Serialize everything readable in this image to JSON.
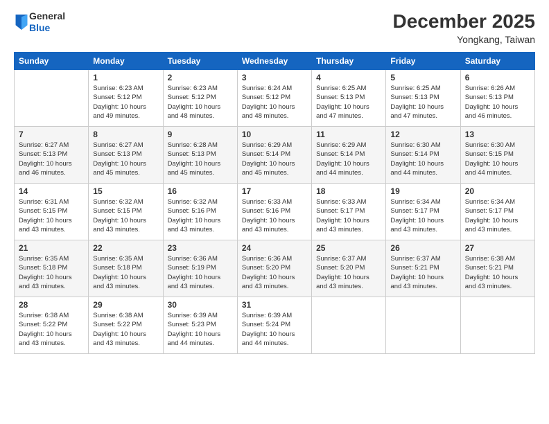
{
  "header": {
    "logo": {
      "general": "General",
      "blue": "Blue"
    },
    "title": "December 2025",
    "location": "Yongkang, Taiwan"
  },
  "calendar": {
    "headers": [
      "Sunday",
      "Monday",
      "Tuesday",
      "Wednesday",
      "Thursday",
      "Friday",
      "Saturday"
    ],
    "weeks": [
      [
        {
          "day": "",
          "info": ""
        },
        {
          "day": "1",
          "info": "Sunrise: 6:23 AM\nSunset: 5:12 PM\nDaylight: 10 hours\nand 49 minutes."
        },
        {
          "day": "2",
          "info": "Sunrise: 6:23 AM\nSunset: 5:12 PM\nDaylight: 10 hours\nand 48 minutes."
        },
        {
          "day": "3",
          "info": "Sunrise: 6:24 AM\nSunset: 5:12 PM\nDaylight: 10 hours\nand 48 minutes."
        },
        {
          "day": "4",
          "info": "Sunrise: 6:25 AM\nSunset: 5:13 PM\nDaylight: 10 hours\nand 47 minutes."
        },
        {
          "day": "5",
          "info": "Sunrise: 6:25 AM\nSunset: 5:13 PM\nDaylight: 10 hours\nand 47 minutes."
        },
        {
          "day": "6",
          "info": "Sunrise: 6:26 AM\nSunset: 5:13 PM\nDaylight: 10 hours\nand 46 minutes."
        }
      ],
      [
        {
          "day": "7",
          "info": "Sunrise: 6:27 AM\nSunset: 5:13 PM\nDaylight: 10 hours\nand 46 minutes."
        },
        {
          "day": "8",
          "info": "Sunrise: 6:27 AM\nSunset: 5:13 PM\nDaylight: 10 hours\nand 45 minutes."
        },
        {
          "day": "9",
          "info": "Sunrise: 6:28 AM\nSunset: 5:13 PM\nDaylight: 10 hours\nand 45 minutes."
        },
        {
          "day": "10",
          "info": "Sunrise: 6:29 AM\nSunset: 5:14 PM\nDaylight: 10 hours\nand 45 minutes."
        },
        {
          "day": "11",
          "info": "Sunrise: 6:29 AM\nSunset: 5:14 PM\nDaylight: 10 hours\nand 44 minutes."
        },
        {
          "day": "12",
          "info": "Sunrise: 6:30 AM\nSunset: 5:14 PM\nDaylight: 10 hours\nand 44 minutes."
        },
        {
          "day": "13",
          "info": "Sunrise: 6:30 AM\nSunset: 5:15 PM\nDaylight: 10 hours\nand 44 minutes."
        }
      ],
      [
        {
          "day": "14",
          "info": "Sunrise: 6:31 AM\nSunset: 5:15 PM\nDaylight: 10 hours\nand 43 minutes."
        },
        {
          "day": "15",
          "info": "Sunrise: 6:32 AM\nSunset: 5:15 PM\nDaylight: 10 hours\nand 43 minutes."
        },
        {
          "day": "16",
          "info": "Sunrise: 6:32 AM\nSunset: 5:16 PM\nDaylight: 10 hours\nand 43 minutes."
        },
        {
          "day": "17",
          "info": "Sunrise: 6:33 AM\nSunset: 5:16 PM\nDaylight: 10 hours\nand 43 minutes."
        },
        {
          "day": "18",
          "info": "Sunrise: 6:33 AM\nSunset: 5:17 PM\nDaylight: 10 hours\nand 43 minutes."
        },
        {
          "day": "19",
          "info": "Sunrise: 6:34 AM\nSunset: 5:17 PM\nDaylight: 10 hours\nand 43 minutes."
        },
        {
          "day": "20",
          "info": "Sunrise: 6:34 AM\nSunset: 5:17 PM\nDaylight: 10 hours\nand 43 minutes."
        }
      ],
      [
        {
          "day": "21",
          "info": "Sunrise: 6:35 AM\nSunset: 5:18 PM\nDaylight: 10 hours\nand 43 minutes."
        },
        {
          "day": "22",
          "info": "Sunrise: 6:35 AM\nSunset: 5:18 PM\nDaylight: 10 hours\nand 43 minutes."
        },
        {
          "day": "23",
          "info": "Sunrise: 6:36 AM\nSunset: 5:19 PM\nDaylight: 10 hours\nand 43 minutes."
        },
        {
          "day": "24",
          "info": "Sunrise: 6:36 AM\nSunset: 5:20 PM\nDaylight: 10 hours\nand 43 minutes."
        },
        {
          "day": "25",
          "info": "Sunrise: 6:37 AM\nSunset: 5:20 PM\nDaylight: 10 hours\nand 43 minutes."
        },
        {
          "day": "26",
          "info": "Sunrise: 6:37 AM\nSunset: 5:21 PM\nDaylight: 10 hours\nand 43 minutes."
        },
        {
          "day": "27",
          "info": "Sunrise: 6:38 AM\nSunset: 5:21 PM\nDaylight: 10 hours\nand 43 minutes."
        }
      ],
      [
        {
          "day": "28",
          "info": "Sunrise: 6:38 AM\nSunset: 5:22 PM\nDaylight: 10 hours\nand 43 minutes."
        },
        {
          "day": "29",
          "info": "Sunrise: 6:38 AM\nSunset: 5:22 PM\nDaylight: 10 hours\nand 43 minutes."
        },
        {
          "day": "30",
          "info": "Sunrise: 6:39 AM\nSunset: 5:23 PM\nDaylight: 10 hours\nand 44 minutes."
        },
        {
          "day": "31",
          "info": "Sunrise: 6:39 AM\nSunset: 5:24 PM\nDaylight: 10 hours\nand 44 minutes."
        },
        {
          "day": "",
          "info": ""
        },
        {
          "day": "",
          "info": ""
        },
        {
          "day": "",
          "info": ""
        }
      ]
    ]
  }
}
